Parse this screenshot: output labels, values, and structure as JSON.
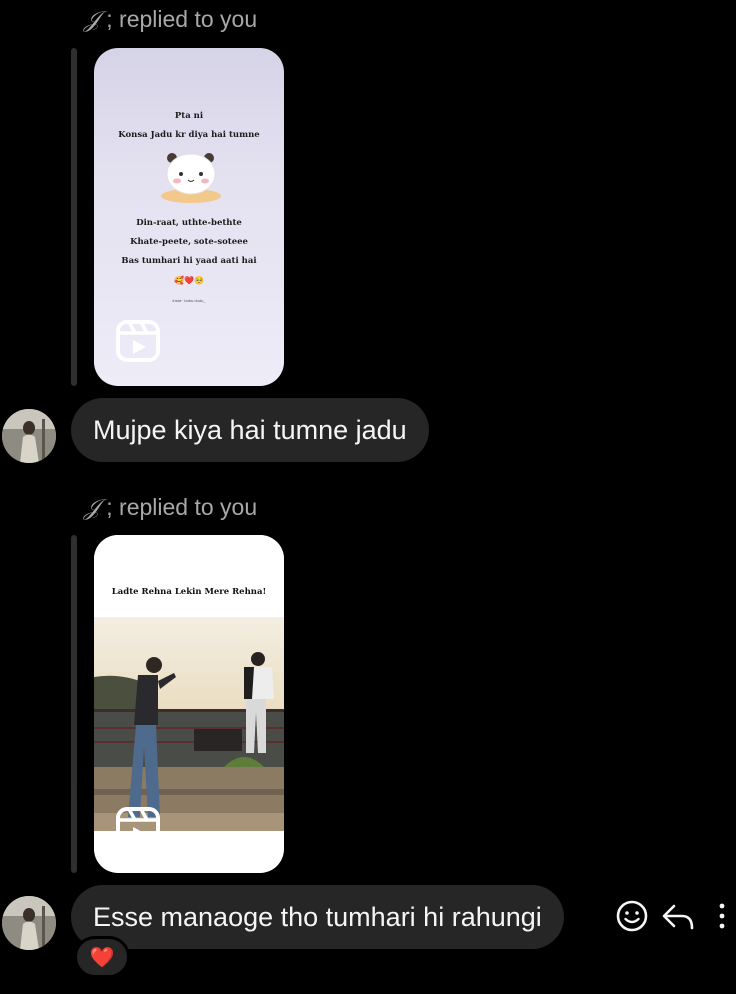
{
  "thread": {
    "messages": [
      {
        "reply_label": {
          "initial": "𝒥",
          "text": "; replied to you"
        },
        "reel": {
          "line1": "Pta ni",
          "line2": "Konsa Jadu kr diya hai tumne",
          "line3": "Din-raat, uthte-bethte",
          "line4": "Khate-peete, sote-soteee",
          "line5": "Bas tumhari hi yaad aati hai",
          "emojis": "🥰❤️🥺",
          "credit": "insta~ bubu.dudu_"
        },
        "text": "Mujpe kiya hai tumne jadu"
      },
      {
        "reply_label": {
          "initial": "𝒥",
          "text": "; replied to you"
        },
        "reel": {
          "caption": "Ladte Rehna Lekin Mere Rehna!"
        },
        "text": "Esse manaoge tho tumhari hi rahungi",
        "reaction": "❤️"
      }
    ]
  },
  "icons": {
    "reel": "reels-icon",
    "react": "emoji-smile-icon",
    "reply": "reply-arrow-icon",
    "more": "more-vertical-icon"
  },
  "colors": {
    "background": "#000000",
    "bubble": "#262626",
    "label": "#a8a8a8",
    "reaction_heart": "#e0245e"
  }
}
